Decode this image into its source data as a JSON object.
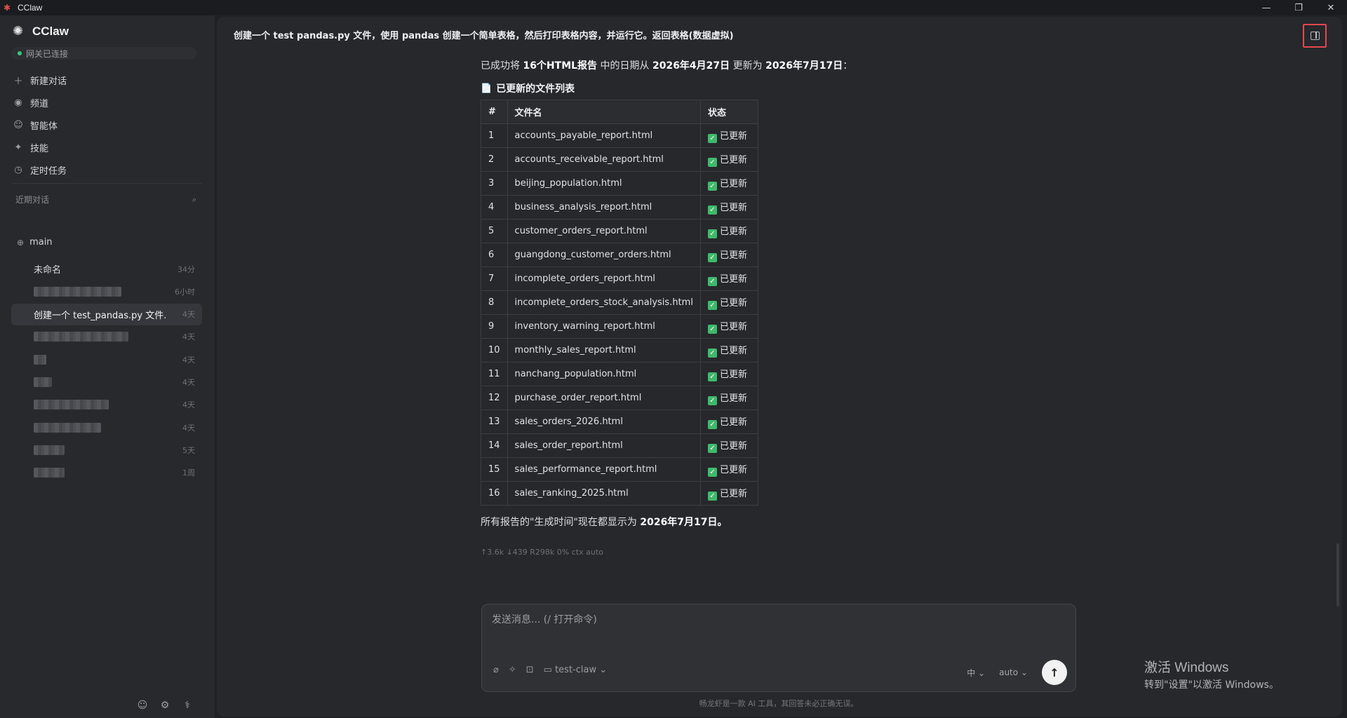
{
  "window": {
    "title": "CClaw",
    "controls": [
      "—",
      "❐",
      "✕"
    ]
  },
  "sidebar": {
    "brand": "CClaw",
    "gateway_status": "网关已连接",
    "nav": [
      {
        "label": "新建对话",
        "icon": "plus-icon"
      },
      {
        "label": "频道",
        "icon": "broadcast-icon"
      },
      {
        "label": "智能体",
        "icon": "agent-icon"
      },
      {
        "label": "技能",
        "icon": "sparkle-icon"
      },
      {
        "label": "定时任务",
        "icon": "clock-icon"
      }
    ],
    "recent_label": "近期对话",
    "group_name": "main",
    "conversations": [
      {
        "title": "未命名",
        "time": "34分",
        "blurred": false
      },
      {
        "title": "",
        "time": "6小时",
        "blurred": true
      },
      {
        "title": "创建一个 test_pandas.py 文件...",
        "time": "4天",
        "blurred": false,
        "active": true
      },
      {
        "title": "",
        "time": "4天",
        "blurred": true
      },
      {
        "title": "",
        "time": "4天",
        "blurred": true
      },
      {
        "title": "",
        "time": "4天",
        "blurred": true
      },
      {
        "title": "",
        "time": "4天",
        "blurred": true
      },
      {
        "title": "",
        "time": "4天",
        "blurred": true
      },
      {
        "title": "",
        "time": "5天",
        "blurred": true
      },
      {
        "title": "",
        "time": "1周",
        "blurred": true
      }
    ]
  },
  "chat": {
    "title": "创建一个 test pandas.py 文件，使用 pandas 创建一个简单表格，然后打印表格内容，并运行它。返回表格(数据虚拟)",
    "intro_pre": "已成功将 ",
    "intro_b1": "16个HTML报告",
    "intro_mid1": " 中的日期从 ",
    "intro_b2": "2026年4月27日",
    "intro_mid2": " 更新为 ",
    "intro_b3": "2026年7月17日",
    "intro_post": "：",
    "subheading": "已更新的文件列表",
    "table_headers": [
      "#",
      "文件名",
      "状态"
    ],
    "status_label": "已更新",
    "files": [
      "accounts_payable_report.html",
      "accounts_receivable_report.html",
      "beijing_population.html",
      "business_analysis_report.html",
      "customer_orders_report.html",
      "guangdong_customer_orders.html",
      "incomplete_orders_report.html",
      "incomplete_orders_stock_analysis.html",
      "inventory_warning_report.html",
      "monthly_sales_report.html",
      "nanchang_population.html",
      "purchase_order_report.html",
      "sales_orders_2026.html",
      "sales_order_report.html",
      "sales_performance_report.html",
      "sales_ranking_2025.html"
    ],
    "outro_pre": "所有报告的\"生成时间\"现在都显示为 ",
    "outro_b": "2026年7月17日。",
    "meta": "↑3.6k ↓439 R298k 0% ctx auto"
  },
  "composer": {
    "placeholder": "发送消息... (/ 打开命令)",
    "project": "test-claw",
    "lang": "中",
    "model": "auto"
  },
  "disclaimer": "畅龙虾是一款 AI 工具，其回答未必正确无误。",
  "watermark": {
    "line1": "激活 Windows",
    "line2": "转到\"设置\"以激活 Windows。"
  }
}
